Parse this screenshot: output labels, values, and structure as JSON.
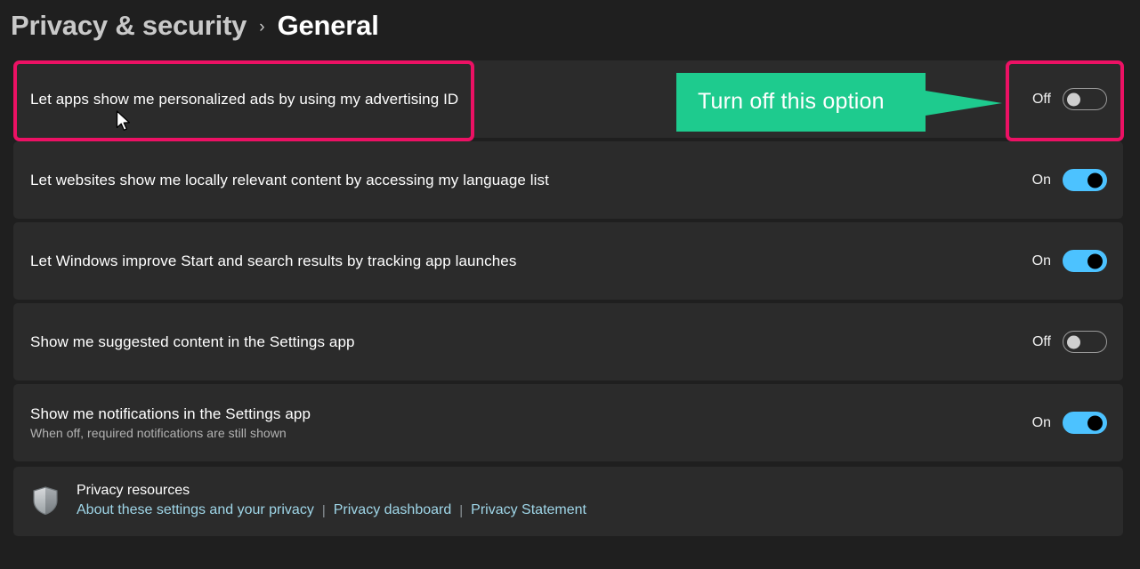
{
  "breadcrumb": {
    "parent": "Privacy & security",
    "chevron": "›",
    "current": "General"
  },
  "settings": [
    {
      "title": "Let apps show me personalized ads by using my advertising ID",
      "subtitle": "",
      "state_label": "Off",
      "state": "off"
    },
    {
      "title": "Let websites show me locally relevant content by accessing my language list",
      "subtitle": "",
      "state_label": "On",
      "state": "on"
    },
    {
      "title": "Let Windows improve Start and search results by tracking app launches",
      "subtitle": "",
      "state_label": "On",
      "state": "on"
    },
    {
      "title": "Show me suggested content in the Settings app",
      "subtitle": "",
      "state_label": "Off",
      "state": "off"
    },
    {
      "title": "Show me notifications in the Settings app",
      "subtitle": "When off, required notifications are still shown",
      "state_label": "On",
      "state": "on"
    }
  ],
  "resources": {
    "icon": "shield-icon",
    "title": "Privacy resources",
    "separator": "|",
    "links": [
      "About these settings and your privacy",
      "Privacy dashboard",
      "Privacy Statement"
    ]
  },
  "annotations": {
    "callout_text": "Turn off this option",
    "callout_color": "#1ecb8e",
    "highlight_color": "#ec1164",
    "highlight_row_target": "Let apps show me personalized ads by using my advertising ID",
    "highlight_toggle_target": "Off"
  },
  "colors": {
    "page_background": "#1f1f1f",
    "row_background": "#2b2b2b",
    "toggle_on": "#4cc2ff",
    "link": "#9fd6e8"
  }
}
